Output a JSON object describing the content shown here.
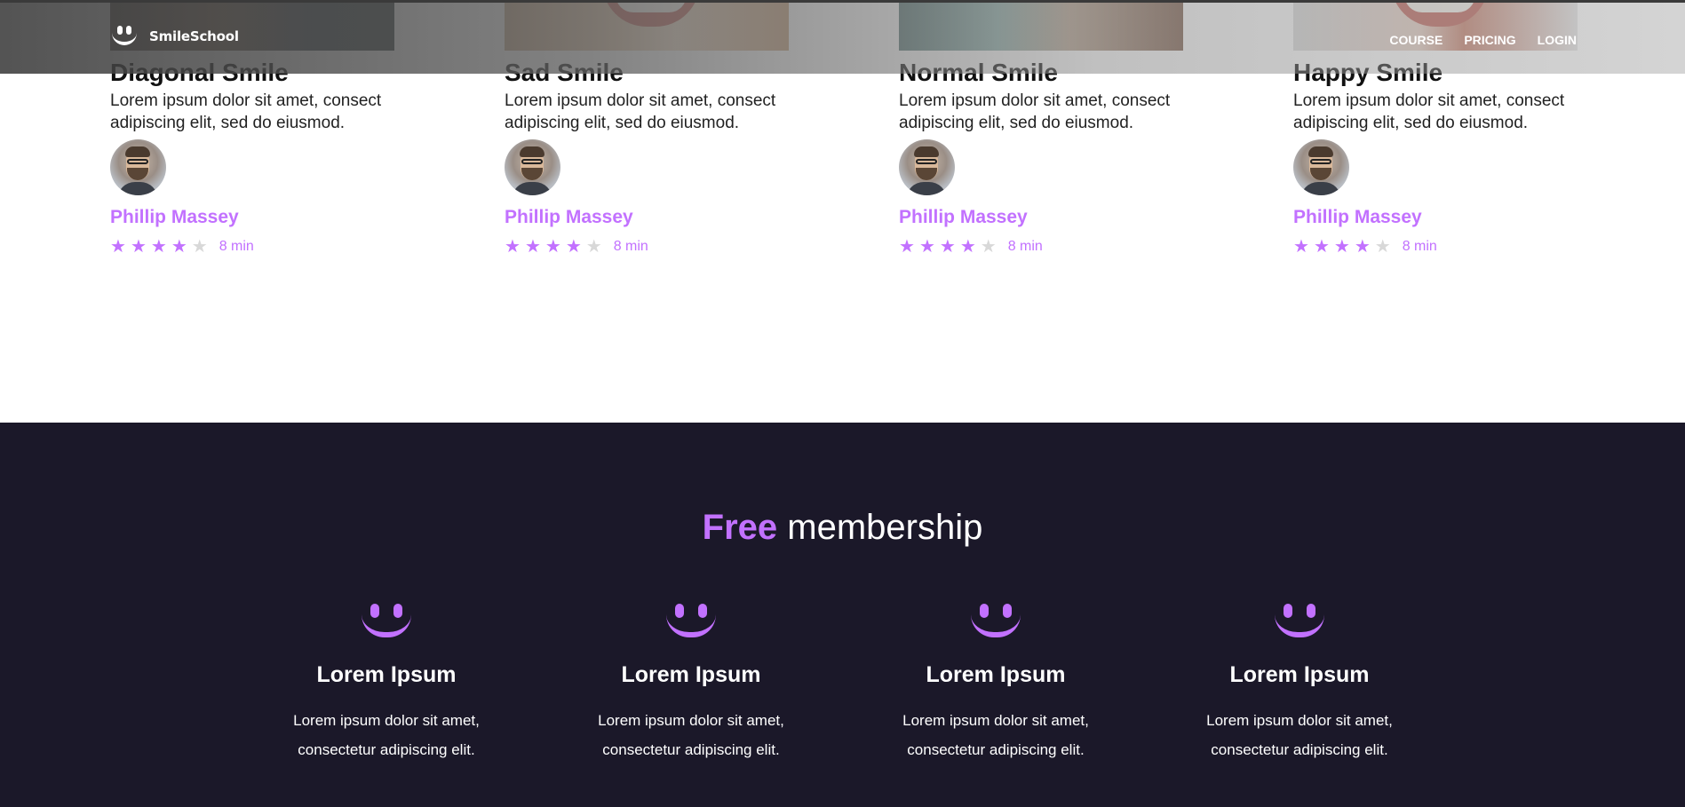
{
  "header": {
    "brand": "SmileSchool",
    "nav": [
      "COURSE",
      "PRICING",
      "LOGIN"
    ]
  },
  "cards": [
    {
      "title": "Diagonal Smile",
      "text": "Lorem ipsum dolor sit amet, consect adipiscing elit, sed do eiusmod.",
      "author": "Phillip Massey",
      "stars": 4,
      "duration": "8 min"
    },
    {
      "title": "Sad Smile",
      "text": "Lorem ipsum dolor sit amet, consect adipiscing elit, sed do eiusmod.",
      "author": "Phillip Massey",
      "stars": 4,
      "duration": "8 min"
    },
    {
      "title": "Normal Smile",
      "text": "Lorem ipsum dolor sit amet, consect adipiscing elit, sed do eiusmod.",
      "author": "Phillip Massey",
      "stars": 4,
      "duration": "8 min"
    },
    {
      "title": "Happy Smile",
      "text": "Lorem ipsum dolor sit amet, consect adipiscing elit, sed do eiusmod.",
      "author": "Phillip Massey",
      "stars": 4,
      "duration": "8 min"
    }
  ],
  "membership": {
    "title_accent": "Free",
    "title_rest": " membership",
    "features": [
      {
        "title": "Lorem Ipsum",
        "line1": "Lorem ipsum dolor sit amet,",
        "line2": "consectetur adipiscing elit."
      },
      {
        "title": "Lorem Ipsum",
        "line1": "Lorem ipsum dolor sit amet,",
        "line2": "consectetur adipiscing elit."
      },
      {
        "title": "Lorem Ipsum",
        "line1": "Lorem ipsum dolor sit amet,",
        "line2": "consectetur adipiscing elit."
      },
      {
        "title": "Lorem Ipsum",
        "line1": "Lorem ipsum dolor sit amet,",
        "line2": "consectetur adipiscing elit."
      }
    ]
  },
  "colors": {
    "accent": "#c271ff",
    "dark_bg": "#1b1829",
    "star_off": "#d8d8d8"
  },
  "icons": {
    "logo": "smile-logo-icon",
    "star": "star-icon",
    "feature": "smile-icon"
  }
}
